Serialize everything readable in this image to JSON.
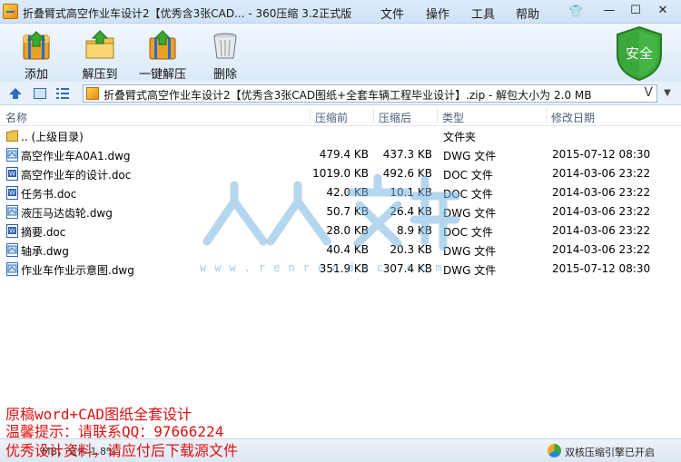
{
  "window": {
    "title": "折叠臂式高空作业车设计2【优秀含3张CAD... - 360压缩 3.2正式版",
    "menu": [
      "文件",
      "操作",
      "工具",
      "帮助"
    ]
  },
  "toolbar": {
    "add_label": "添加",
    "extract_label": "解压到",
    "oneclick_label": "一键解压",
    "delete_label": "删除",
    "security_label": "安全"
  },
  "address": {
    "path": "折叠臂式高空作业车设计2【优秀含3张CAD图纸+全套车辆工程毕业设计】.zip - 解包大小为 2.0 MB",
    "v_mark": "V"
  },
  "columns": {
    "name": "名称",
    "size": "压缩前",
    "packed": "压缩后",
    "type": "类型",
    "date": "修改日期"
  },
  "files": [
    {
      "name": ".. (上级目录)",
      "size": "",
      "packed": "",
      "type": "文件夹",
      "date": "",
      "kind": "folder"
    },
    {
      "name": "高空作业车A0A1.dwg",
      "size": "479.4 KB",
      "packed": "437.3 KB",
      "type": "DWG 文件",
      "date": "2015-07-12 08:30",
      "kind": "dwg"
    },
    {
      "name": "高空作业车的设计.doc",
      "size": "1019.0 KB",
      "packed": "492.6 KB",
      "type": "DOC 文件",
      "date": "2014-03-06 23:22",
      "kind": "doc"
    },
    {
      "name": "任务书.doc",
      "size": "42.0 KB",
      "packed": "10.1 KB",
      "type": "DOC 文件",
      "date": "2014-03-06 23:22",
      "kind": "doc"
    },
    {
      "name": "液压马达齿轮.dwg",
      "size": "50.7 KB",
      "packed": "26.4 KB",
      "type": "DWG 文件",
      "date": "2014-03-06 23:22",
      "kind": "dwg"
    },
    {
      "name": "摘要.doc",
      "size": "28.0 KB",
      "packed": "8.9 KB",
      "type": "DOC 文件",
      "date": "2014-03-06 23:22",
      "kind": "doc"
    },
    {
      "name": "轴承.dwg",
      "size": "40.4 KB",
      "packed": "20.3 KB",
      "type": "DWG 文件",
      "date": "2014-03-06 23:22",
      "kind": "dwg"
    },
    {
      "name": "作业车作业示意图.dwg",
      "size": "351.9 KB",
      "packed": "307.4 KB",
      "type": "DWG 文件",
      "date": "2015-07-12 08:30",
      "kind": "dwg"
    }
  ],
  "watermark": {
    "text": "www.renrendoc.com",
    "big_chars": [
      "人",
      "人",
      "文",
      "库"
    ]
  },
  "overlay": {
    "line1": "原稿word+CAD图纸全套设计",
    "line2": "温馨提示：请联系QQ：97666224",
    "line3": "优秀设计资料，请应付后下载源文件"
  },
  "status": {
    "left": "MB，文件 1.8%",
    "right": "双核压缩引擎已开启"
  },
  "colors": {
    "accent": "#2a6dc3",
    "overlay_red": "#e01010",
    "security_green": "#3aa83a"
  }
}
